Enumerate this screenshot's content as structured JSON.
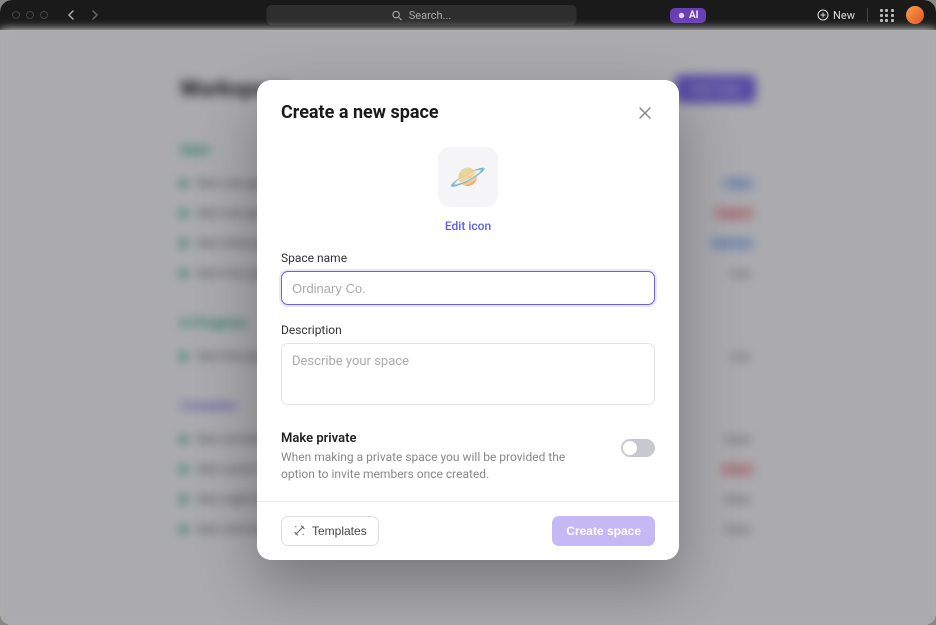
{
  "topbar": {
    "search_placeholder": "Search...",
    "ai_label": "AI",
    "new_label": "New"
  },
  "background": {
    "page_title": "Workspace",
    "primary_btn": "Add Task",
    "sections": [
      {
        "title": "Open",
        "rows": [
          {
            "name": "Design review",
            "col1": "Today",
            "col2": "High"
          },
          {
            "name": "Sprint planning",
            "col1": "Mon",
            "col2": "Normal"
          }
        ]
      }
    ]
  },
  "modal": {
    "title": "Create a new space",
    "icon": "🪐",
    "edit_icon_label": "Edit icon",
    "name_label": "Space name",
    "name_placeholder": "Ordinary Co.",
    "description_label": "Description",
    "description_placeholder": "Describe your space",
    "private_title": "Make private",
    "private_desc": "When making a private space you will be provided the option to invite members once created.",
    "templates_label": "Templates",
    "create_label": "Create space"
  }
}
